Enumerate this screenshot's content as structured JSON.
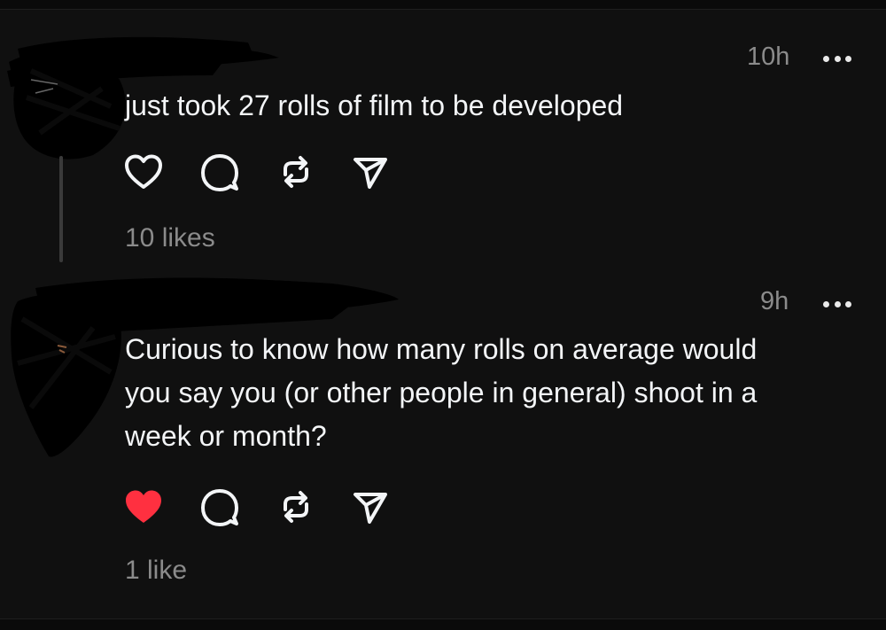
{
  "colors": {
    "background": "#101010",
    "text": "#f3f5f7",
    "muted": "#8b8b8b",
    "like_active": "#ff3040"
  },
  "posts": [
    {
      "timestamp": "10h",
      "text": "just took 27 rolls of film to be developed",
      "liked": false,
      "likes_label": "10 likes",
      "icons": [
        "heart-icon",
        "comment-icon",
        "repost-icon",
        "share-icon"
      ]
    },
    {
      "timestamp": "9h",
      "text_lines": [
        "Curious to know how many rolls on average would",
        "you say you (or other people in general) shoot in a",
        "week or month?"
      ],
      "liked": true,
      "likes_label": "1 like",
      "icons": [
        "heart-filled-icon",
        "comment-icon",
        "repost-icon",
        "share-icon"
      ]
    }
  ]
}
